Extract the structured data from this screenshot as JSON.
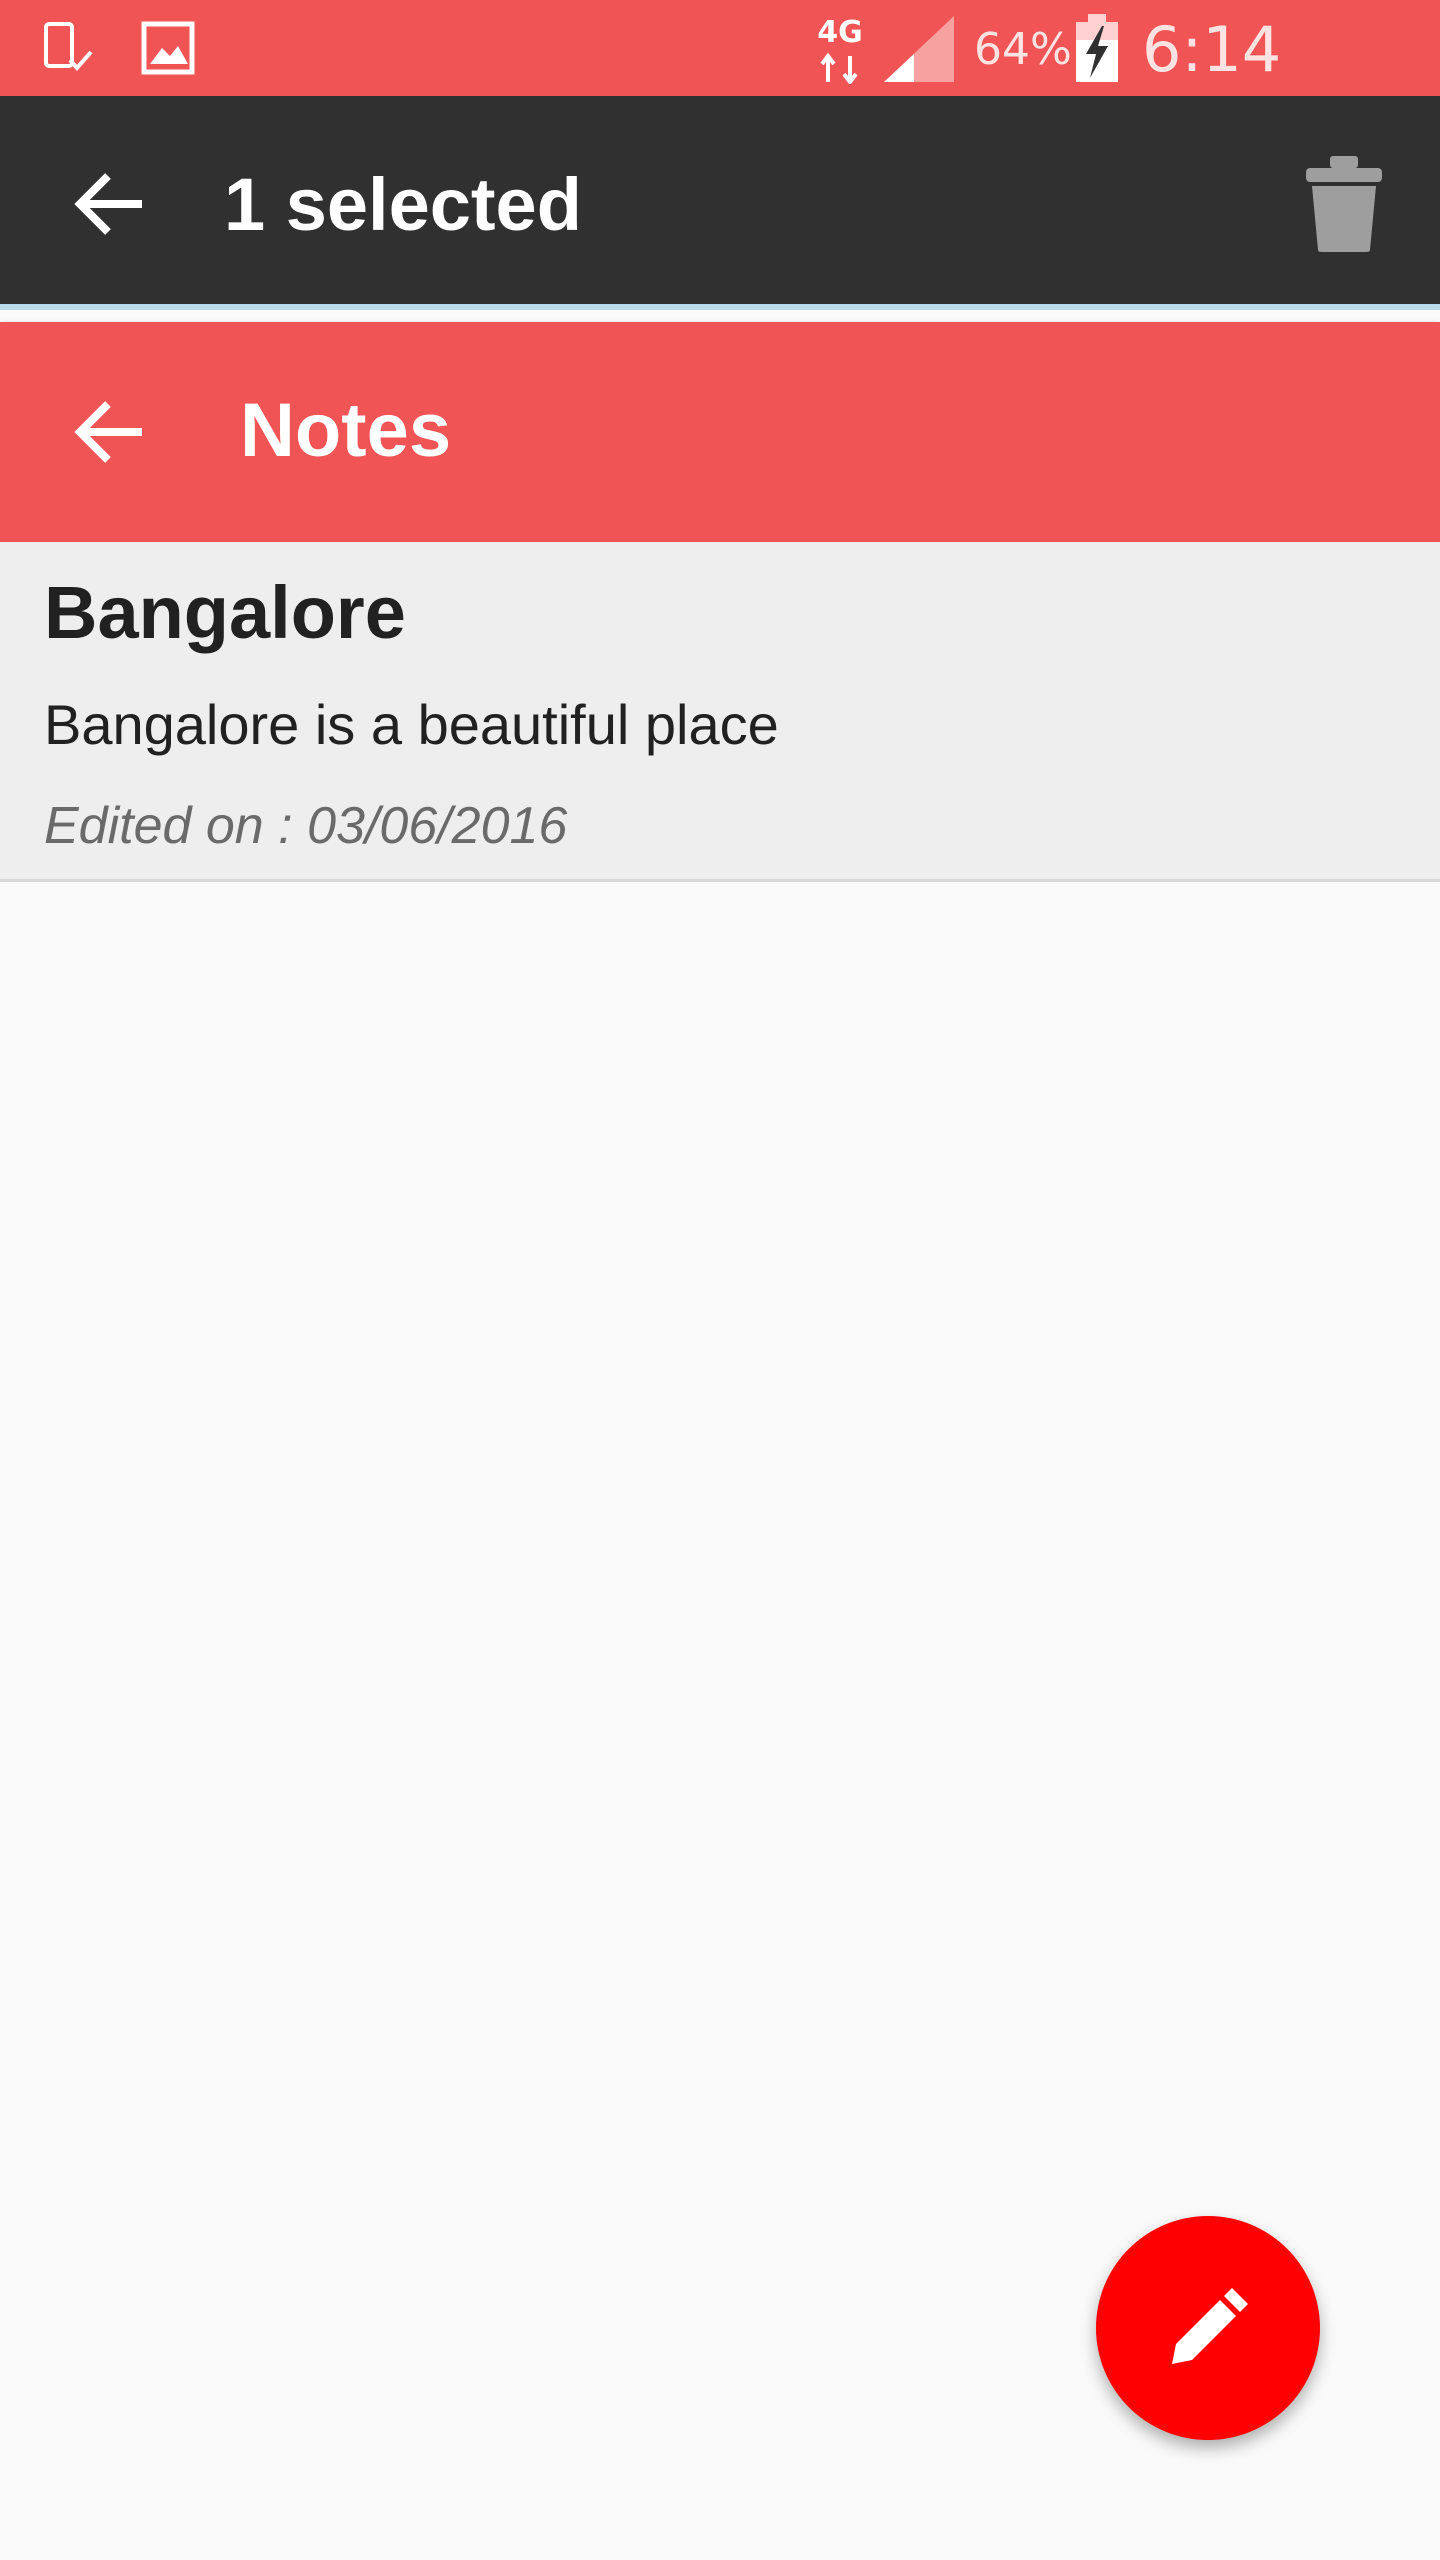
{
  "status_bar": {
    "network": "4G",
    "battery_percent": "64%",
    "time": "6:14 p.m.",
    "icons": [
      "device-check-icon",
      "image-icon",
      "data-transfer-icon",
      "signal-icon",
      "battery-charging-icon"
    ],
    "color": "#f05454"
  },
  "action_mode": {
    "title": "1 selected",
    "back_icon": "arrow-back-icon",
    "delete_icon": "trash-icon",
    "color": "#303030"
  },
  "toolbar": {
    "title": "Notes",
    "back_icon": "arrow-back-icon",
    "color": "#f05454"
  },
  "notes": [
    {
      "title": "Bangalore",
      "body": "Bangalore is a beautiful place",
      "edited": "Edited on : 03/06/2016",
      "selected": true
    }
  ],
  "fab": {
    "icon": "pencil-icon",
    "color": "#ff0000"
  }
}
